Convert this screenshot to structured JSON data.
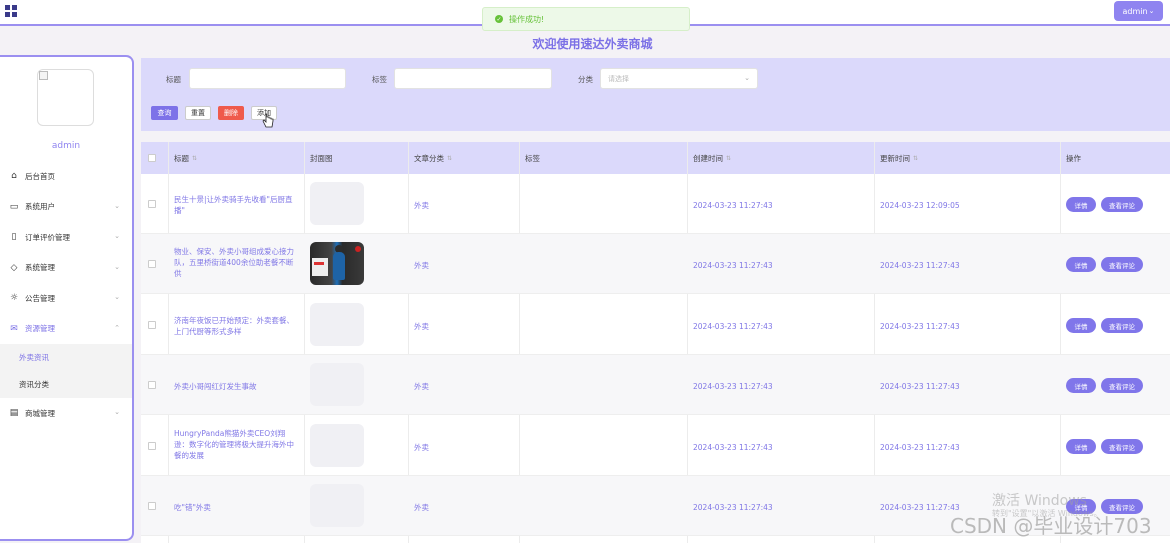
{
  "header": {
    "admin_label": "admin",
    "toast_text": "操作成功!"
  },
  "page_title": "欢迎使用速达外卖商城",
  "sidebar": {
    "username": "admin",
    "items": [
      {
        "label": "后台首页",
        "icon": "home-icon"
      },
      {
        "label": "系统用户",
        "icon": "monitor-icon"
      },
      {
        "label": "订单评价管理",
        "icon": "bookmark-icon"
      },
      {
        "label": "系统管理",
        "icon": "tag-icon"
      },
      {
        "label": "公告管理",
        "icon": "sun-icon"
      },
      {
        "label": "资源管理",
        "icon": "inbox-icon"
      },
      {
        "label": "商城管理",
        "icon": "clipboard-icon"
      }
    ],
    "subitems": [
      {
        "label": "外卖资讯"
      },
      {
        "label": "资讯分类"
      }
    ]
  },
  "search": {
    "title_label": "标题",
    "tag_label": "标签",
    "category_label": "分类",
    "category_placeholder": "请选择",
    "query_button": "查询",
    "reset_button": "重置",
    "delete_button": "删除",
    "add_button": "添加"
  },
  "table": {
    "columns": [
      "标题",
      "封面图",
      "文章分类",
      "标签",
      "创建时间",
      "更新时间",
      "操作"
    ],
    "detail_label": "详情",
    "comment_label": "查看评论",
    "rows": [
      {
        "title": "民生十景|让外卖骑手先收看\"后厨直播\"",
        "category": "外卖",
        "tag": "",
        "created": "2024-03-23 11:27:43",
        "updated": "2024-03-23 12:09:05",
        "cover": "blank"
      },
      {
        "title": "物业、保安、外卖小哥组成爱心接力队，五里桥街道400余位助老餐不断供",
        "category": "外卖",
        "tag": "",
        "created": "2024-03-23 11:27:43",
        "updated": "2024-03-23 11:27:43",
        "cover": "photo"
      },
      {
        "title": "济南年夜饭已开始预定：外卖套餐、上门代厨等形式多样",
        "category": "外卖",
        "tag": "",
        "created": "2024-03-23 11:27:43",
        "updated": "2024-03-23 11:27:43",
        "cover": "blank"
      },
      {
        "title": "外卖小哥闯红灯发生事故",
        "category": "外卖",
        "tag": "",
        "created": "2024-03-23 11:27:43",
        "updated": "2024-03-23 11:27:43",
        "cover": "blank"
      },
      {
        "title": "HungryPanda熊猫外卖CEO刘翔逊：数字化的管理将极大提升海外中餐的发展",
        "category": "外卖",
        "tag": "",
        "created": "2024-03-23 11:27:43",
        "updated": "2024-03-23 11:27:43",
        "cover": "blank"
      },
      {
        "title": "吃\"错\"外卖",
        "category": "外卖",
        "tag": "",
        "created": "2024-03-23 11:27:43",
        "updated": "2024-03-23 11:27:43",
        "cover": "blank"
      }
    ]
  },
  "overlay": {
    "windows_text": "激活 Windows",
    "windows_sub": "转到\"设置\"以激活 Windows。",
    "csdn_text": "CSDN @毕业设计703"
  },
  "colors": {
    "accent": "#8f84f0",
    "danger": "#ef5a4b",
    "success": "#67c23a"
  }
}
